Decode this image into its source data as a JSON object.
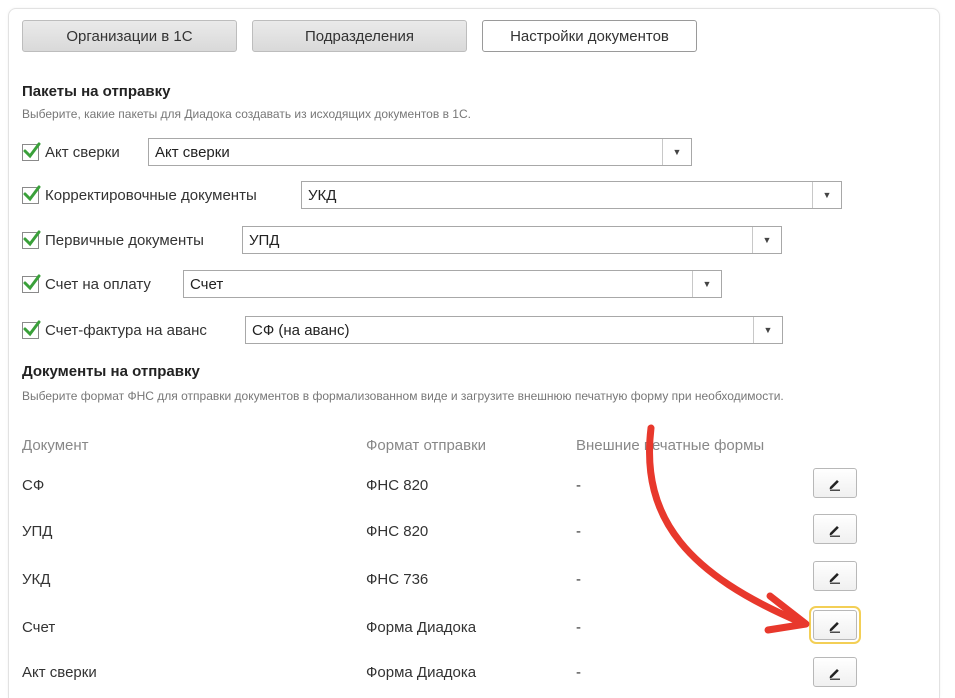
{
  "tabs": [
    {
      "label": "Организации в 1С"
    },
    {
      "label": "Подразделения"
    },
    {
      "label": "Настройки документов"
    }
  ],
  "packages": {
    "title": "Пакеты на отправку",
    "hint": "Выберите, какие пакеты для Диадока создавать из исходящих документов в 1С.",
    "rows": [
      {
        "label": "Акт сверки",
        "value": "Акт сверки",
        "checked": true
      },
      {
        "label": "Корректировочные документы",
        "value": "УКД",
        "checked": true
      },
      {
        "label": "Первичные документы",
        "value": "УПД",
        "checked": true
      },
      {
        "label": "Счет на оплату",
        "value": "Счет",
        "checked": true
      },
      {
        "label": "Счет-фактура на аванс",
        "value": "СФ (на аванс)",
        "checked": true
      }
    ]
  },
  "documents": {
    "title": "Документы на отправку",
    "hint": "Выберите формат ФНС для отправки документов в формализованном виде и загрузите внешнюю печатную форму при необходимости.",
    "columns": [
      "Документ",
      "Формат отправки",
      "Внешние печатные формы"
    ],
    "rows": [
      {
        "doc": "СФ",
        "format": "ФНС 820",
        "external": "-"
      },
      {
        "doc": "УПД",
        "format": "ФНС 820",
        "external": "-"
      },
      {
        "doc": "УКД",
        "format": "ФНС 736",
        "external": "-"
      },
      {
        "doc": "Счет",
        "format": "Форма Диадока",
        "external": "-"
      },
      {
        "doc": "Акт сверки",
        "format": "Форма Диадока",
        "external": "-"
      }
    ]
  },
  "icons": {
    "checkbox": "check-icon",
    "dropdown": "triangle-down-icon",
    "edit": "pencil-icon",
    "annotation": "red-arrow"
  },
  "colors": {
    "check": "#3aa03a",
    "arrow": "#e8382c",
    "focus": "#f3cf56"
  }
}
